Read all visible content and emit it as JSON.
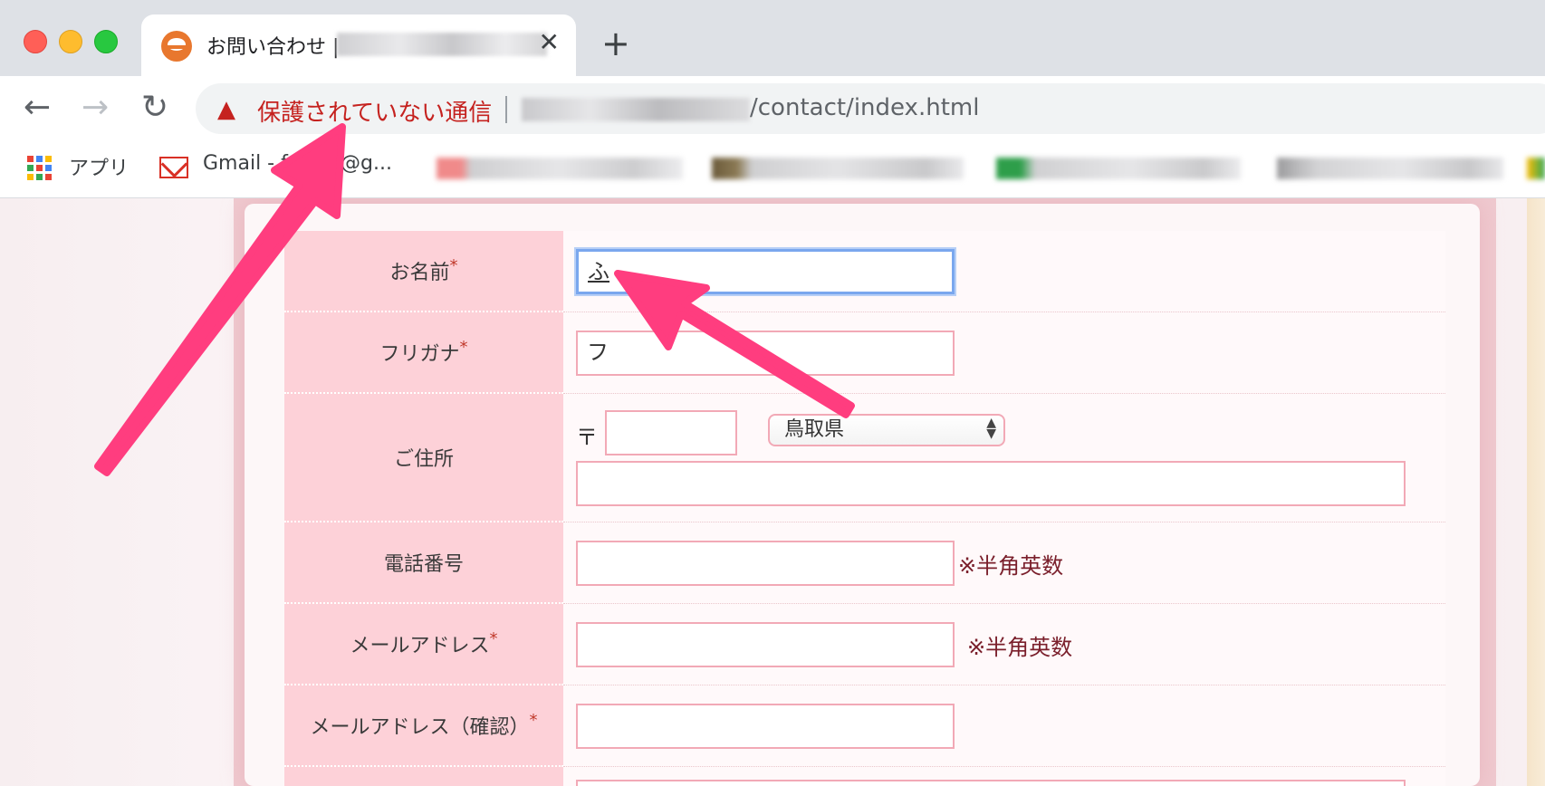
{
  "browser": {
    "tab_title": "お問い合わせ | ",
    "tab_close": "✕",
    "new_tab": "+",
    "back": "←",
    "forward": "→",
    "reload": "↻",
    "security_icon": "▲",
    "security_text": "保護されていない通信",
    "url_path": "/contact/index.html"
  },
  "bookmarks": {
    "apps_label": "アプリ",
    "gmail_label": "Gmail - f",
    "gmail_suffix": "@g...",
    "apps_colors": [
      "#ea4335",
      "#4285f4",
      "#fbbc05",
      "#34a853",
      "#ea4335",
      "#4285f4",
      "#fbbc05",
      "#34a853",
      "#ea4335"
    ]
  },
  "form": {
    "rows": [
      {
        "label": "お名前",
        "required": "*",
        "value": "ふ"
      },
      {
        "label": "フリガナ",
        "required": "*",
        "value": "フ"
      },
      {
        "label": "ご住所",
        "required": "",
        "postal_mark": "〒",
        "prefecture": "鳥取県"
      },
      {
        "label": "電話番号",
        "required": "",
        "note": "※半角英数"
      },
      {
        "label": "メールアドレス",
        "required": "*",
        "note": "※半角英数"
      },
      {
        "label": "メールアドレス（確認）",
        "required": "*"
      }
    ]
  },
  "annotation": {
    "arrow_color": "#ff3d7f"
  }
}
